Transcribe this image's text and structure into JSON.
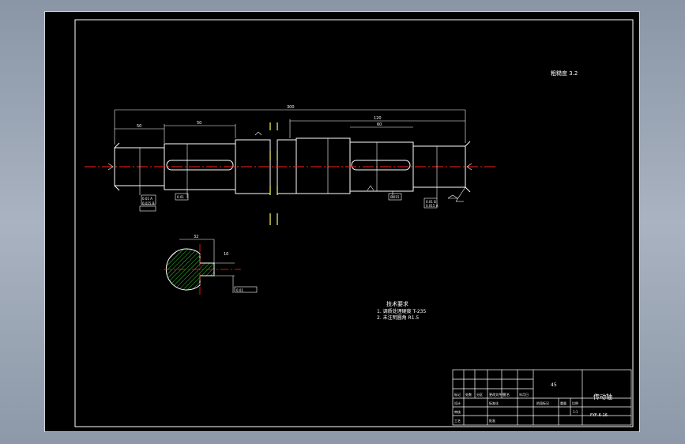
{
  "drawing": {
    "surface_note": "粗糙度 3.2",
    "dimensions": {
      "overall": "300",
      "left_length": "50",
      "keyway_left": "50",
      "right_length": "120",
      "right_section": "60",
      "section_width": "32",
      "section_depth": "10"
    },
    "tolerance_boxes": [
      "0.01 A",
      "0.015 B",
      "0.01",
      "0.015",
      "0.01 B",
      "0.015 A",
      "0.01"
    ],
    "tech_req": {
      "title": "技术要求",
      "items": [
        "1. 调质处理硬度 T-235",
        "2. 未注明圆角 R1.5"
      ]
    },
    "title_block": {
      "part_name": "传动轴",
      "drawing_no": "FYF-6-16",
      "material": "45",
      "scale": "1:1",
      "weight": "",
      "header_cells": [
        "标记",
        "处数",
        "分区",
        "更改文件号",
        "签名",
        "年月日"
      ],
      "row_labels": [
        "设计",
        "审核",
        "工艺",
        "标准化",
        "批准"
      ],
      "stage_label": "阶段标记",
      "qty_label": "重量",
      "ratio_label": "比例"
    }
  },
  "colors": {
    "outline": "#ffffff",
    "center": "#ff2020",
    "dimension": "#ffffff",
    "hatch": "#33cc33",
    "phantom": "#ffff66"
  }
}
